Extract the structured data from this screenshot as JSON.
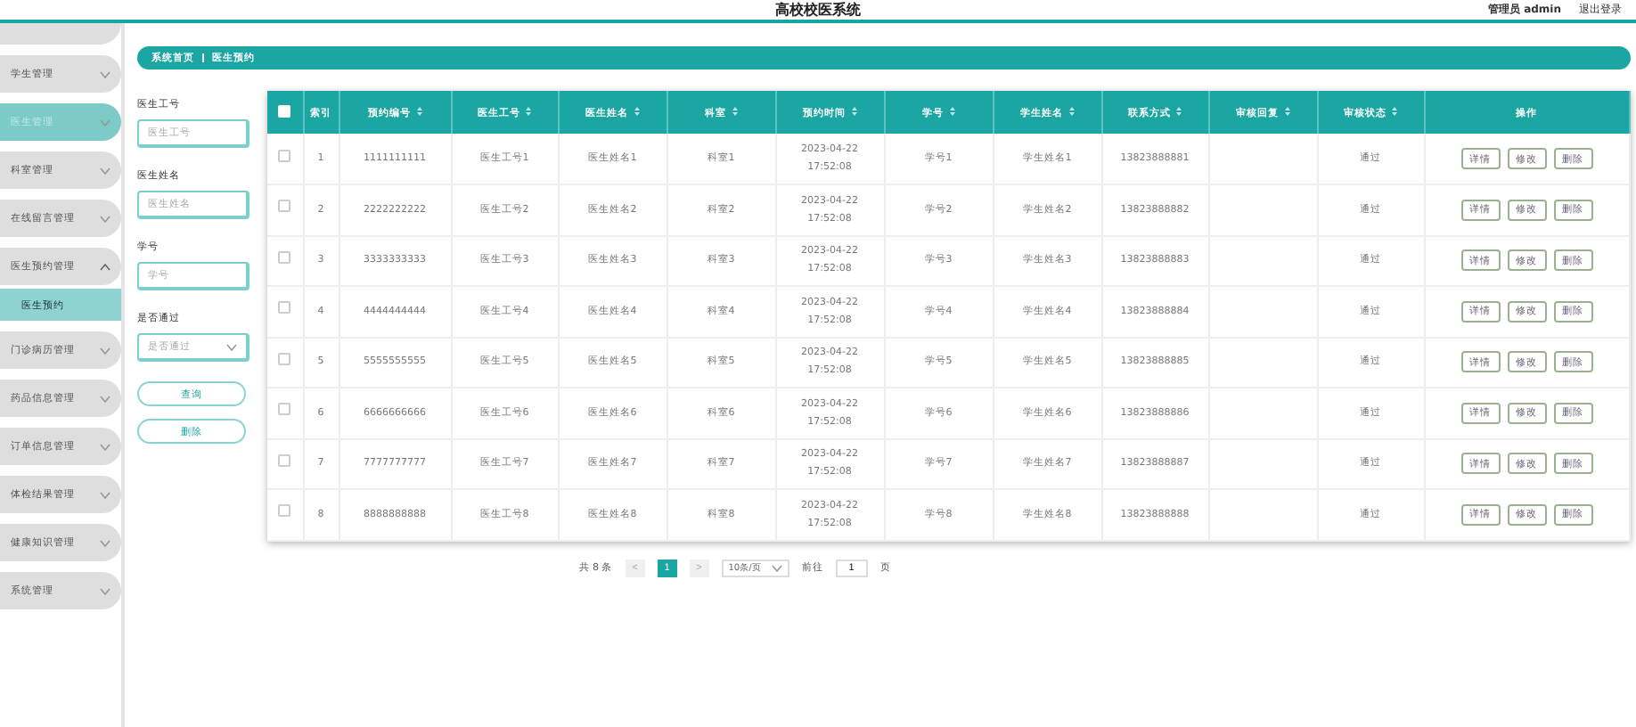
{
  "header": {
    "title": "高校校医系统",
    "user": "管理员 admin",
    "logout": "退出登录"
  },
  "sidebar": {
    "items": [
      {
        "kind": "partial",
        "selected": false
      },
      {
        "kind": "menu",
        "label": "学生管理",
        "selected": false,
        "expanded": false
      },
      {
        "kind": "menu",
        "label": "医生管理",
        "selected": true,
        "expanded": false
      },
      {
        "kind": "menu",
        "label": "科室管理",
        "selected": false,
        "expanded": false
      },
      {
        "kind": "menu",
        "label": "在线留言管理",
        "selected": false,
        "expanded": false
      },
      {
        "kind": "menu",
        "label": "医生预约管理",
        "selected": false,
        "expanded": true,
        "children": [
          {
            "label": "医生预约",
            "selected": true
          }
        ]
      },
      {
        "kind": "menu",
        "label": "门诊病历管理",
        "selected": false,
        "expanded": false
      },
      {
        "kind": "menu",
        "label": "药品信息管理",
        "selected": false,
        "expanded": false
      },
      {
        "kind": "menu",
        "label": "订单信息管理",
        "selected": false,
        "expanded": false
      },
      {
        "kind": "menu",
        "label": "体检结果管理",
        "selected": false,
        "expanded": false
      },
      {
        "kind": "menu",
        "label": "健康知识管理",
        "selected": false,
        "expanded": false
      },
      {
        "kind": "menu",
        "label": "系统管理",
        "selected": false,
        "expanded": false
      }
    ]
  },
  "breadcrumb": [
    "系统首页",
    "医生预约"
  ],
  "search": {
    "fields": [
      {
        "kind": "text",
        "label": "医生工号",
        "placeholder": "医生工号"
      },
      {
        "kind": "text",
        "label": "医生姓名",
        "placeholder": "医生姓名"
      },
      {
        "kind": "text",
        "label": "学号",
        "placeholder": "学号"
      },
      {
        "kind": "select",
        "label": "是否通过",
        "placeholder": "是否通过"
      }
    ],
    "buttons": [
      "查询",
      "删除"
    ]
  },
  "table": {
    "all_checked": false,
    "columns": [
      {
        "label": "索引",
        "sortable": false
      },
      {
        "label": "预约编号",
        "sortable": true
      },
      {
        "label": "医生工号",
        "sortable": true
      },
      {
        "label": "医生姓名",
        "sortable": true
      },
      {
        "label": "科室",
        "sortable": true
      },
      {
        "label": "预约时间",
        "sortable": true
      },
      {
        "label": "学号",
        "sortable": true
      },
      {
        "label": "学生姓名",
        "sortable": true
      },
      {
        "label": "联系方式",
        "sortable": true
      },
      {
        "label": "审核回复",
        "sortable": true
      },
      {
        "label": "审核状态",
        "sortable": true
      },
      {
        "label": "操作",
        "sortable": false
      }
    ],
    "rows": [
      {
        "checked": false,
        "cells": [
          "1",
          "1111111111",
          "医生工号1",
          "医生姓名1",
          "科室1",
          "2023-04-22 17:52:08",
          "学号1",
          "学生姓名1",
          "13823888881",
          null,
          "通过"
        ],
        "actions": [
          "详情",
          "修改",
          "删除"
        ]
      },
      {
        "checked": false,
        "cells": [
          "2",
          "2222222222",
          "医生工号2",
          "医生姓名2",
          "科室2",
          "2023-04-22 17:52:08",
          "学号2",
          "学生姓名2",
          "13823888882",
          null,
          "通过"
        ],
        "actions": [
          "详情",
          "修改",
          "删除"
        ]
      },
      {
        "checked": false,
        "cells": [
          "3",
          "3333333333",
          "医生工号3",
          "医生姓名3",
          "科室3",
          "2023-04-22 17:52:08",
          "学号3",
          "学生姓名3",
          "13823888883",
          null,
          "通过"
        ],
        "actions": [
          "详情",
          "修改",
          "删除"
        ]
      },
      {
        "checked": false,
        "cells": [
          "4",
          "4444444444",
          "医生工号4",
          "医生姓名4",
          "科室4",
          "2023-04-22 17:52:08",
          "学号4",
          "学生姓名4",
          "13823888884",
          null,
          "通过"
        ],
        "actions": [
          "详情",
          "修改",
          "删除"
        ]
      },
      {
        "checked": false,
        "cells": [
          "5",
          "5555555555",
          "医生工号5",
          "医生姓名5",
          "科室5",
          "2023-04-22 17:52:08",
          "学号5",
          "学生姓名5",
          "13823888885",
          null,
          "通过"
        ],
        "actions": [
          "详情",
          "修改",
          "删除"
        ]
      },
      {
        "checked": false,
        "cells": [
          "6",
          "6666666666",
          "医生工号6",
          "医生姓名6",
          "科室6",
          "2023-04-22 17:52:08",
          "学号6",
          "学生姓名6",
          "13823888886",
          null,
          "通过"
        ],
        "actions": [
          "详情",
          "修改",
          "删除"
        ]
      },
      {
        "checked": false,
        "cells": [
          "7",
          "7777777777",
          "医生工号7",
          "医生姓名7",
          "科室7",
          "2023-04-22 17:52:08",
          "学号7",
          "学生姓名7",
          "13823888887",
          null,
          "通过"
        ],
        "actions": [
          "详情",
          "修改",
          "删除"
        ]
      },
      {
        "checked": false,
        "cells": [
          "8",
          "8888888888",
          "医生工号8",
          "医生姓名8",
          "科室8",
          "2023-04-22 17:52:08",
          "学号8",
          "学生姓名8",
          "13823888888",
          null,
          "通过"
        ],
        "actions": [
          "详情",
          "修改",
          "删除"
        ]
      }
    ]
  },
  "pagination": {
    "total": "共 8 条",
    "prev": "<",
    "pages": [
      {
        "label": "1",
        "selected": true
      }
    ],
    "next": ">",
    "page_size": "10条/页",
    "goto": "前往",
    "goto_value": "1",
    "page_unit": "页"
  }
}
